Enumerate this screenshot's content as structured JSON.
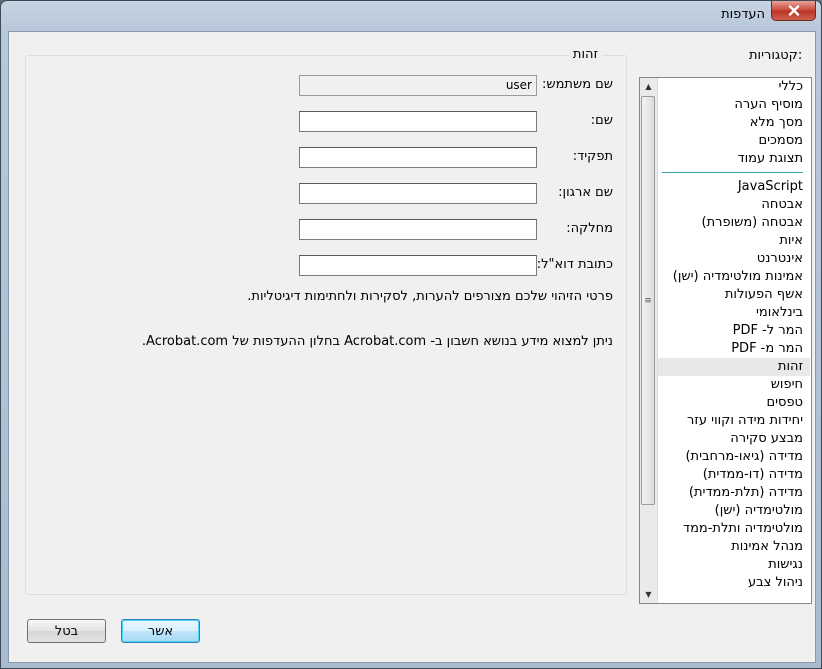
{
  "window": {
    "title": "העדפות",
    "close_icon": "close-icon"
  },
  "categories": {
    "label": "קטגוריות:",
    "items_top": [
      "כללי",
      "מוסיף הערה",
      "מסך מלא",
      "מסמכים",
      "תצוגת עמוד"
    ],
    "items_bottom": [
      "JavaScript",
      "אבטחה",
      "אבטחה (משופרת)",
      "איות",
      "אינטרנט",
      "אמינות מולטימדיה (ישן)",
      "אשף הפעולות",
      "בינלאומי",
      "המר ל- PDF",
      "המר מ- PDF",
      "זהות",
      "חיפוש",
      "טפסים",
      "יחידות מידה וקווי עזר",
      "מבצע סקירה",
      "מדידה (גיאו-מרחבית)",
      "מדידה (דו-ממדית)",
      "מדידה (תלת-ממדית)",
      "מולטימדיה (ישן)",
      "מולטימדיה ותלת-ממד",
      "מנהל אמינות",
      "נגישות",
      "ניהול צבע"
    ],
    "selected": "זהות"
  },
  "identity": {
    "title": "זהות",
    "fields": [
      {
        "label": "שם משתמש:",
        "value": "user"
      },
      {
        "label": "שם:",
        "value": ""
      },
      {
        "label": "תפקיד:",
        "value": ""
      },
      {
        "label": "שם ארגון:",
        "value": ""
      },
      {
        "label": "מחלקה:",
        "value": ""
      },
      {
        "label": "כתובת דוא\"ל:",
        "value": ""
      }
    ],
    "info1": "פרטי הזיהוי שלכם מצורפים להערות, לסקירות ולחתימות דיגיטליות.",
    "info2": "ניתן למצוא מידע בנושא חשבון ב- Acrobat.com בחלון ההעדפות של Acrobat.com."
  },
  "buttons": {
    "ok": "אשר",
    "cancel": "בטל"
  }
}
